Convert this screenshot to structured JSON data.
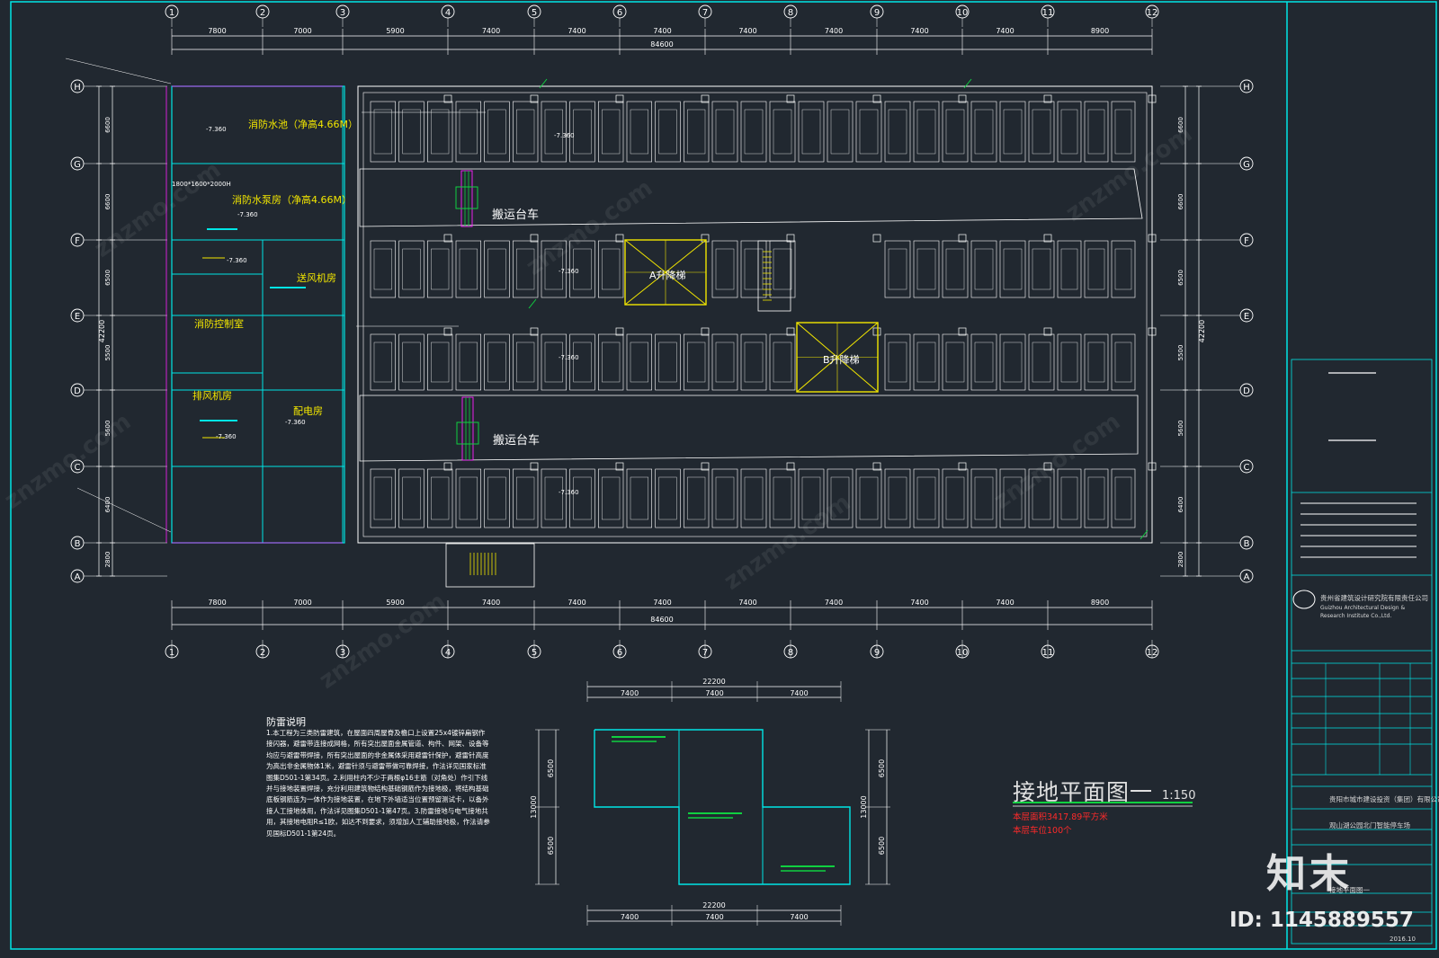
{
  "drawing": {
    "title": "接地平面图一",
    "scale": "1:150",
    "area_text": "本层面积3417.89平方米",
    "spaces_text": "本层车位100个"
  },
  "grid": {
    "columns": [
      "1",
      "2",
      "3",
      "4",
      "5",
      "6",
      "7",
      "8",
      "9",
      "10",
      "11",
      "12"
    ],
    "rows": [
      "H",
      "G",
      "F",
      "E",
      "D",
      "C",
      "B",
      "A"
    ],
    "spans": [
      "7800",
      "7000",
      "5900",
      "7400",
      "7400",
      "7400",
      "7400",
      "7400",
      "7400",
      "7400",
      "8900"
    ],
    "total": "84600",
    "row_dims_left": [
      "6600",
      "6600",
      "6500",
      "5500",
      "5600",
      "6400",
      "2800"
    ],
    "row_total": "42200"
  },
  "rooms": {
    "fire_pool": "消防水池（净高4.66M）",
    "fire_pump": "消防水泵房（净高4.66M）",
    "supply_fan": "送风机房",
    "fire_control": "消防控制室",
    "exhaust_fan": "排风机房",
    "power_room": "配电房",
    "pit_size": "1800*1600*2000H",
    "level": "-7.360"
  },
  "carts": {
    "upper": "搬运台车",
    "lower": "搬运台车"
  },
  "lifts": {
    "a": "A升降梯",
    "b": "B升降梯"
  },
  "notes": {
    "title": "防雷说明",
    "body": "1.本工程为三类防雷建筑，在屋面四周屋脊及檐口上设置25x4镀锌扁钢作接闪器，避雷带连接成网格，所有突出屋面金属管道、构件、网架、设备等均应与避雷带焊接，所有突出屋面的非金属体采用避雷针保护，避雷针高度为高出非金属物体1米，避雷针须与避雷带做可靠焊接，作法详见国家标准图集D501-1第34页。2.利用柱内不少于两根φ16主筋（对角处）作引下线并与接地装置焊接，充分利用建筑物结构基础钢筋作为接地极，将结构基础底板钢筋连为一体作为接地装置，在地下外墙适当位置预留测试卡，以备外接人工接地体用，作法详见图集D501-1第47页。3.防雷接地与电气接地共用，其接地电阻R≤1欧，如达不到要求，须增加人工辅助接地极，作法请参见国标D501-1第24页。"
  },
  "small_plan": {
    "spans": [
      "7400",
      "7400",
      "7400"
    ],
    "total": "22200",
    "height_dims": [
      "6500",
      "6500"
    ],
    "height_total": "13000"
  },
  "title_block": {
    "company_cn": "贵州省建筑设计研究院有限责任公司",
    "company_en": "Guizhou Architectural Design & Research Institute Co.,Ltd.",
    "client": "贵阳市城市建设投资（集团）有限公司",
    "project": "观山湖公园北门智能停车场",
    "drawing_name": "接地平面图一",
    "date": "2016.10"
  },
  "watermark": {
    "brand": "知末",
    "id": "ID: 1145889557",
    "site": "znzmo.com"
  },
  "colors": {
    "background": "#212830",
    "lines": "#ffffff",
    "room_text": "#f2e600",
    "cyan": "#00e5e5",
    "green": "#10d040",
    "lift_yellow": "#f2e600",
    "magenta": "#ff20ff",
    "red": "#ff2a2a"
  }
}
